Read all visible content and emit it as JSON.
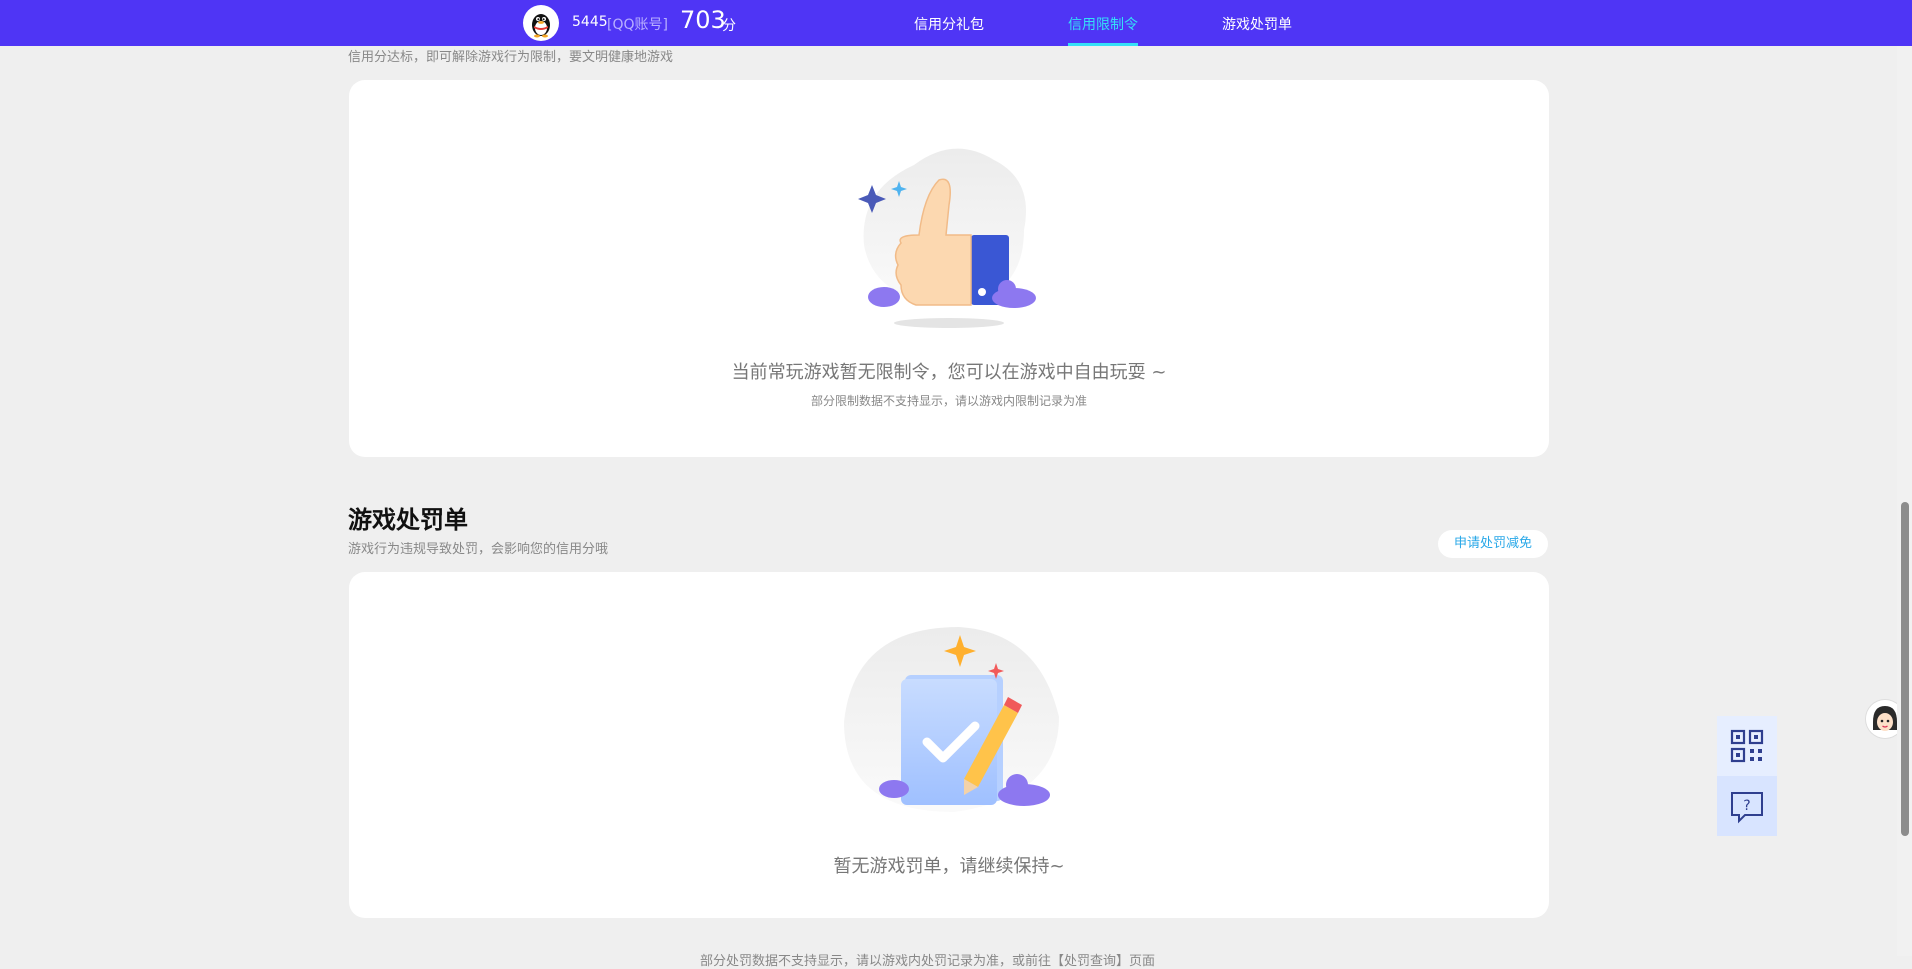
{
  "header": {
    "account_number": "5445",
    "account_type": "[QQ账号]",
    "score": "703",
    "score_unit": "分",
    "nav": [
      {
        "label": "信用分礼包",
        "active": false
      },
      {
        "label": "信用限制令",
        "active": true
      },
      {
        "label": "游戏处罚单",
        "active": false
      }
    ]
  },
  "restriction": {
    "subtitle": "信用分达标，即可解除游戏行为限制，要文明健康地游戏",
    "empty_main": "当前常玩游戏暂无限制令，您可以在游戏中自由玩耍 ~",
    "empty_sub": "部分限制数据不支持显示，请以游戏内限制记录为准"
  },
  "penalty": {
    "title": "游戏处罚单",
    "subtitle": "游戏行为违规导致处罚，会影响您的信用分哦",
    "apply_button": "申请处罚减免",
    "empty_main": "暂无游戏罚单，请继续保持~"
  },
  "footnote": "部分处罚数据不支持显示，请以游戏内处罚记录为准，或前往【处罚查询】页面",
  "icons": {
    "qr": "qr-code-icon",
    "help": "help-chat-icon",
    "service": "customer-service-avatar-icon"
  }
}
